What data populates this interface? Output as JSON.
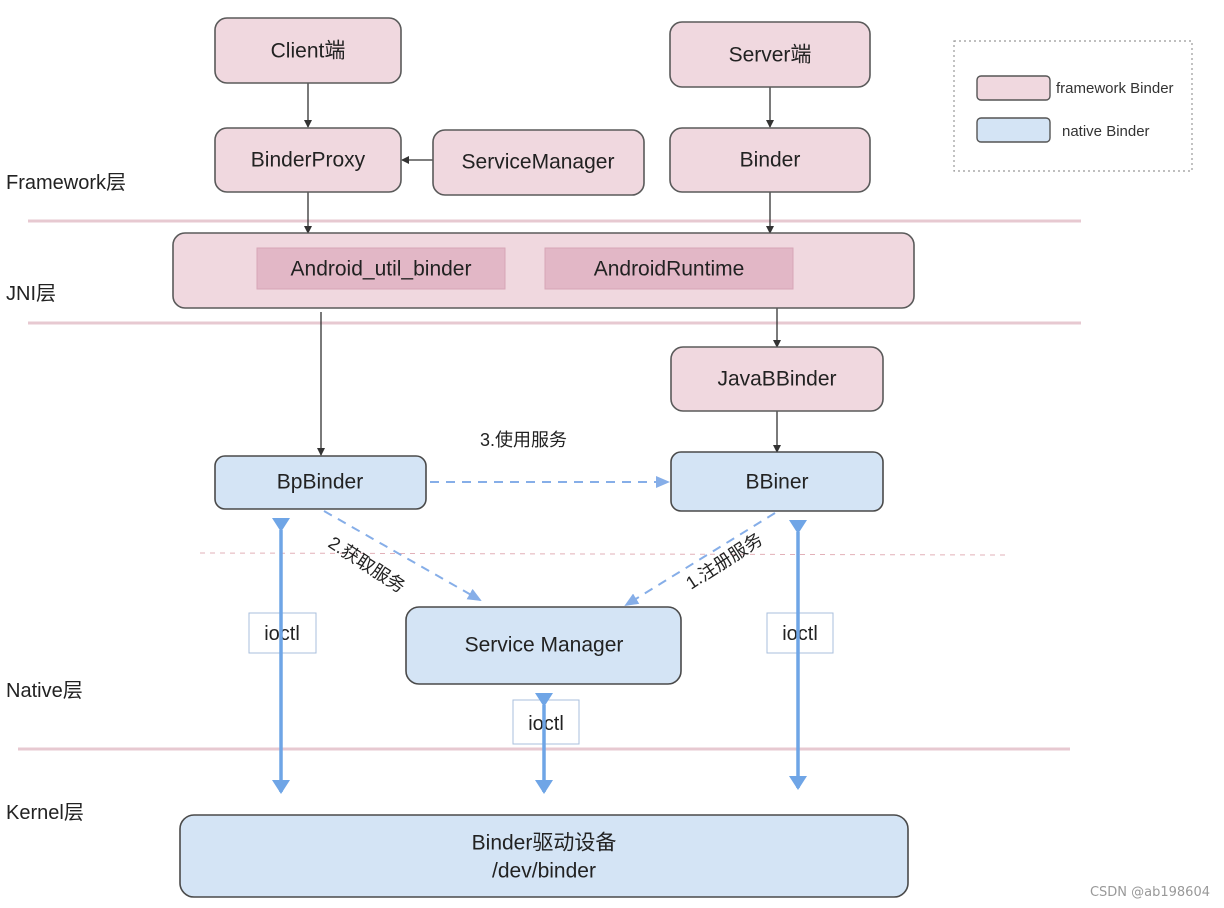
{
  "layers": [
    {
      "id": "framework",
      "label": "Framework层"
    },
    {
      "id": "jni",
      "label": "JNI层"
    },
    {
      "id": "native",
      "label": "Native层"
    },
    {
      "id": "kernel",
      "label": "Kernel层"
    }
  ],
  "nodes": {
    "client": {
      "label": "Client端",
      "kind": "framework"
    },
    "server": {
      "label": "Server端",
      "kind": "framework"
    },
    "binder_proxy": {
      "label": "BinderProxy",
      "kind": "framework"
    },
    "service_manager_fw": {
      "label": "ServiceManager",
      "kind": "framework"
    },
    "binder": {
      "label": "Binder",
      "kind": "framework"
    },
    "jni_container": {
      "kind": "framework"
    },
    "android_util_binder": {
      "label": "Android_util_binder"
    },
    "android_runtime": {
      "label": "AndroidRuntime"
    },
    "java_bbinder": {
      "label": "JavaBBinder",
      "kind": "framework"
    },
    "bp_binder": {
      "label": "BpBinder",
      "kind": "native"
    },
    "bbiner": {
      "label": "BBiner",
      "kind": "native"
    },
    "service_manager_native": {
      "label": "Service Manager",
      "kind": "native"
    },
    "binder_driver": {
      "label_line1": "Binder驱动设备",
      "label_line2": "/dev/binder",
      "kind": "native"
    }
  },
  "edges": {
    "use_service": {
      "label": "3.使用服务",
      "from": "bp_binder",
      "to": "bbiner",
      "style": "dashed"
    },
    "get_service": {
      "label": "2.获取服务",
      "from": "bp_binder",
      "to": "service_manager_native",
      "style": "dashed"
    },
    "register_service": {
      "label": "1.注册服务",
      "from": "bbiner",
      "to": "service_manager_native",
      "style": "dashed"
    },
    "ioctl_left": {
      "label": "ioctl",
      "style": "bidirectional"
    },
    "ioctl_center": {
      "label": "ioctl",
      "style": "bidirectional"
    },
    "ioctl_right": {
      "label": "ioctl",
      "style": "bidirectional"
    }
  },
  "legend": {
    "items": [
      {
        "label": "framework Binder",
        "color": "#f0d8df"
      },
      {
        "label": "native Binder",
        "color": "#d4e4f5"
      }
    ]
  },
  "colors": {
    "framework_fill": "#f0d8df",
    "native_fill": "#d4e4f5",
    "ioctl_arrow": "#6fa5e6",
    "separator": "#e7c9d1"
  },
  "watermark": "CSDN @ab198604"
}
